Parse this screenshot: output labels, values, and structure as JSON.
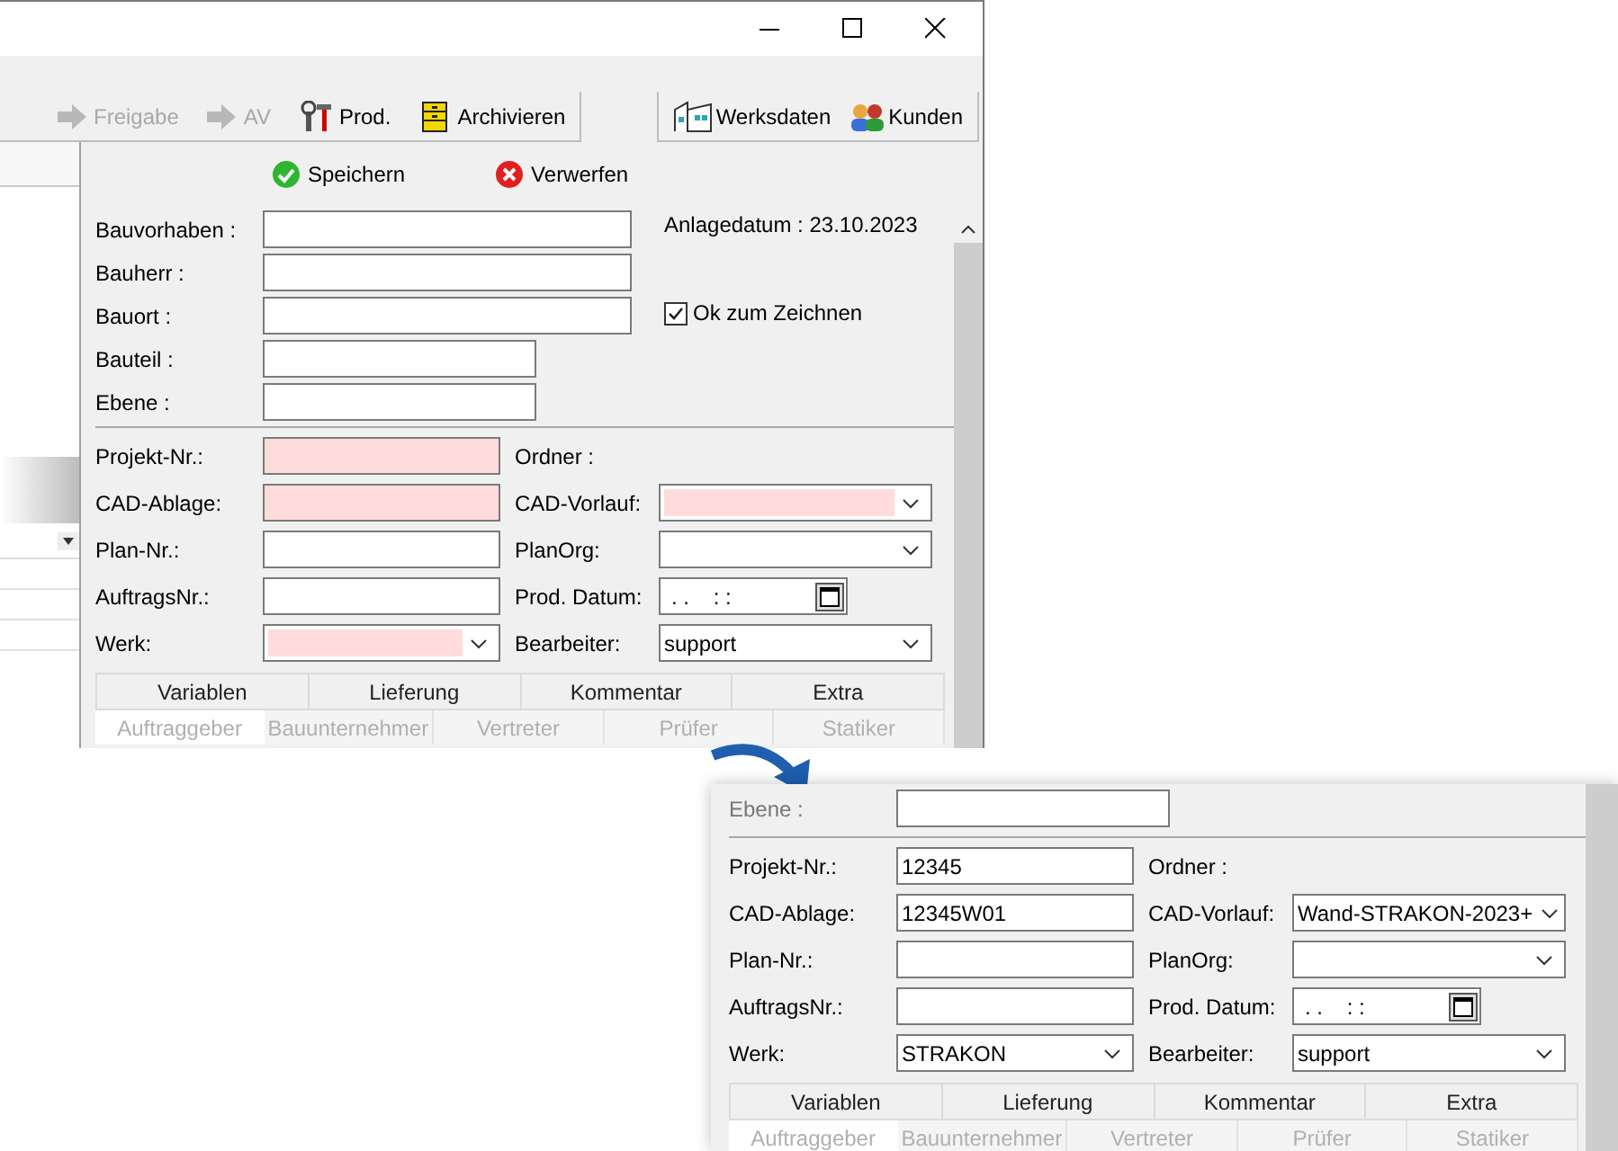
{
  "toolbar": {
    "left": [
      {
        "label": "Freigabe",
        "kind": "arrow",
        "disabled": true
      },
      {
        "label": "AV",
        "kind": "arrow",
        "disabled": true
      },
      {
        "label": "Prod.",
        "kind": "tools",
        "disabled": false
      },
      {
        "label": "Archivieren",
        "kind": "cabinet",
        "disabled": false
      }
    ],
    "right": [
      {
        "label": "Werksdaten",
        "kind": "factory"
      },
      {
        "label": "Kunden",
        "kind": "people"
      }
    ]
  },
  "actions": [
    {
      "label": "Speichern",
      "kind": "ok"
    },
    {
      "label": "Verwerfen",
      "kind": "cancel"
    }
  ],
  "form": {
    "top_fields": [
      {
        "label": "Bauvorhaben :",
        "kind": "wide"
      },
      {
        "label": "Bauherr :",
        "kind": "wide"
      },
      {
        "label": "Bauort :",
        "kind": "wide"
      },
      {
        "label": "Bauteil :",
        "kind": "narrow"
      },
      {
        "label": "Ebene :",
        "kind": "narrow"
      }
    ],
    "created": "Anlagedatum : 23.10.2023",
    "ok_to_draw": {
      "label": "Ok zum Zeichnen",
      "checked": true
    },
    "rows": [
      {
        "left": {
          "label": "Projekt-Nr.:",
          "kind": "text",
          "required": true
        },
        "right": {
          "label": "Ordner :"
        }
      },
      {
        "left": {
          "label": "CAD-Ablage:",
          "kind": "text",
          "required": true
        },
        "right": {
          "label": "CAD-Vorlauf:",
          "kind": "select",
          "required": true
        }
      },
      {
        "left": {
          "label": "Plan-Nr.:",
          "kind": "text",
          "required": false
        },
        "right": {
          "label": "PlanOrg:",
          "kind": "select",
          "required": false
        }
      },
      {
        "left": {
          "label": "AuftragsNr.:",
          "kind": "text",
          "required": false
        },
        "right": {
          "label": "Prod. Datum:",
          "kind": "date",
          "required": false,
          "value": ". .    : :"
        }
      },
      {
        "left": {
          "label": "Werk:",
          "kind": "select",
          "required": true
        },
        "right": {
          "label": "Bearbeiter:",
          "kind": "select",
          "required": false,
          "value": "support"
        }
      }
    ],
    "tabs_row1": [
      {
        "label": "Variablen"
      },
      {
        "label": "Lieferung"
      },
      {
        "label": "Kommentar"
      },
      {
        "label": "Extra"
      }
    ],
    "tabs_row2": [
      {
        "label": "Auftraggeber",
        "selected": true
      },
      {
        "label": "Bauunternehmer",
        "selected": false
      },
      {
        "label": "Vertreter",
        "selected": false
      },
      {
        "label": "Prüfer",
        "selected": false
      },
      {
        "label": "Statiker",
        "selected": false
      }
    ]
  },
  "zoom_view": {
    "top_field": {
      "label": "Ebene :"
    },
    "rows": [
      {
        "left": {
          "label": "Projekt-Nr.:",
          "kind": "text",
          "required": false,
          "value": "12345"
        },
        "right": {
          "label": "Ordner :"
        }
      },
      {
        "left": {
          "label": "CAD-Ablage:",
          "kind": "text",
          "required": false,
          "value": "12345W01"
        },
        "right": {
          "label": "CAD-Vorlauf:",
          "kind": "select",
          "required": false,
          "value": "Wand-STRAKON-2023+"
        }
      },
      {
        "left": {
          "label": "Plan-Nr.:",
          "kind": "text",
          "required": false
        },
        "right": {
          "label": "PlanOrg:",
          "kind": "select",
          "required": false
        }
      },
      {
        "left": {
          "label": "AuftragsNr.:",
          "kind": "text",
          "required": false
        },
        "right": {
          "label": "Prod. Datum:",
          "kind": "date",
          "required": false,
          "value": ". .    : :"
        }
      },
      {
        "left": {
          "label": "Werk:",
          "kind": "select",
          "required": false,
          "value": "STRAKON"
        },
        "right": {
          "label": "Bearbeiter:",
          "kind": "select",
          "required": false,
          "value": "support"
        }
      }
    ],
    "tabs_row1": [
      {
        "label": "Variablen"
      },
      {
        "label": "Lieferung"
      },
      {
        "label": "Kommentar"
      },
      {
        "label": "Extra"
      }
    ],
    "tabs_row2": [
      {
        "label": "Auftraggeber",
        "selected": true
      },
      {
        "label": "Bauunternehmer",
        "selected": false
      },
      {
        "label": "Vertreter",
        "selected": false
      },
      {
        "label": "Prüfer",
        "selected": false
      },
      {
        "label": "Statiker",
        "selected": false
      }
    ]
  }
}
